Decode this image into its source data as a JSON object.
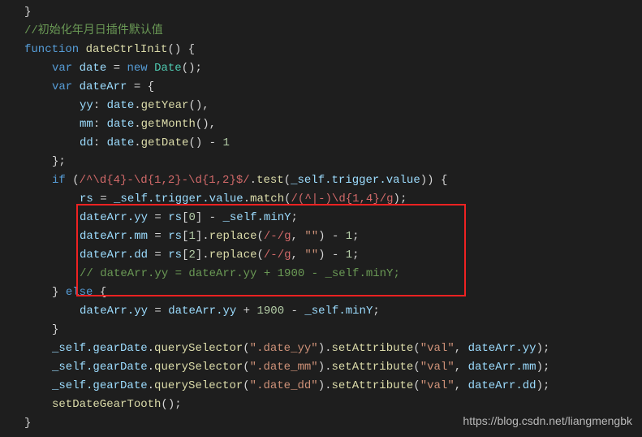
{
  "code": {
    "l1": "}",
    "l2_comment": "//初始化年月日插件默认值",
    "l3_kw_function": "function",
    "l3_name": " dateCtrlInit",
    "l3_rest": "() {",
    "l4_kw_var": "var",
    "l4_var_date": " date",
    "l4_eq": " = ",
    "l4_kw_new": "new",
    "l4_space": " ",
    "l4_class": "Date",
    "l4_rest": "();",
    "l5_kw_var": "var",
    "l5_var": " dateArr",
    "l5_rest": " = {",
    "l6_prop": "yy",
    "l6_colon": ": ",
    "l6_obj": "date",
    "l6_dot": ".",
    "l6_method": "getYear",
    "l6_rest": "(),",
    "l7_prop": "mm",
    "l7_colon": ": ",
    "l7_obj": "date",
    "l7_dot": ".",
    "l7_method": "getMonth",
    "l7_rest": "(),",
    "l8_prop": "dd",
    "l8_colon": ": ",
    "l8_obj": "date",
    "l8_dot": ".",
    "l8_method": "getDate",
    "l8_rest": "() - ",
    "l8_num": "1",
    "l9": "};",
    "l10_kw_if": "if",
    "l10_open": " (",
    "l10_regex": "/^\\d{4}-\\d{1,2}-\\d{1,2}$/",
    "l10_dot": ".",
    "l10_method": "test",
    "l10_open2": "(",
    "l10_obj": "_self",
    "l10_prop1": ".trigger",
    "l10_prop2": ".value",
    "l10_rest": ")) {",
    "l11_var": "rs",
    "l11_eq": " = ",
    "l11_obj": "_self",
    "l11_prop1": ".trigger",
    "l11_prop2": ".value",
    "l11_dot": ".",
    "l11_method": "match",
    "l11_open": "(",
    "l11_regex": "/(^|-)\\d{1,4}/g",
    "l11_rest": ");",
    "l12_obj": "dateArr",
    "l12_prop": ".yy",
    "l12_eq": " = ",
    "l12_rs": "rs",
    "l12_idx_open": "[",
    "l12_idx": "0",
    "l12_idx_close": "]",
    "l12_minus": " - ",
    "l12_self": "_self",
    "l12_miny": ".minY",
    "l12_semi": ";",
    "l13_obj": "dateArr",
    "l13_prop": ".mm",
    "l13_eq": " = ",
    "l13_rs": "rs",
    "l13_idx_open": "[",
    "l13_idx": "1",
    "l13_idx_close": "]",
    "l13_dot": ".",
    "l13_method": "replace",
    "l13_open": "(",
    "l13_regex": "/-/g",
    "l13_comma": ", ",
    "l13_str": "\"\"",
    "l13_close": ")",
    "l13_minus": " - ",
    "l13_num": "1",
    "l13_semi": ";",
    "l14_obj": "dateArr",
    "l14_prop": ".dd",
    "l14_eq": " = ",
    "l14_rs": "rs",
    "l14_idx_open": "[",
    "l14_idx": "2",
    "l14_idx_close": "]",
    "l14_dot": ".",
    "l14_method": "replace",
    "l14_open": "(",
    "l14_regex": "/-/g",
    "l14_comma": ", ",
    "l14_str": "\"\"",
    "l14_close": ")",
    "l14_minus": " - ",
    "l14_num": "1",
    "l14_semi": ";",
    "l15_comment": "// dateArr.yy = dateArr.yy + 1900 - _self.minY;",
    "l16_close": "} ",
    "l16_kw_else": "else",
    "l16_open": " {",
    "l17_obj": "dateArr",
    "l17_prop": ".yy",
    "l17_eq": " = ",
    "l17_obj2": "dateArr",
    "l17_prop2": ".yy",
    "l17_plus": " + ",
    "l17_num": "1900",
    "l17_minus": " - ",
    "l17_self": "_self",
    "l17_miny": ".minY",
    "l17_semi": ";",
    "l18": "}",
    "l19_obj": "_self",
    "l19_prop": ".gearDate",
    "l19_dot": ".",
    "l19_method": "querySelector",
    "l19_open": "(",
    "l19_str": "\".date_yy\"",
    "l19_close": ").",
    "l19_method2": "setAttribute",
    "l19_open2": "(",
    "l19_str2": "\"val\"",
    "l19_comma": ", ",
    "l19_obj2": "dateArr",
    "l19_prop2": ".yy",
    "l19_rest": ");",
    "l20_obj": "_self",
    "l20_prop": ".gearDate",
    "l20_dot": ".",
    "l20_method": "querySelector",
    "l20_open": "(",
    "l20_str": "\".date_mm\"",
    "l20_close": ").",
    "l20_method2": "setAttribute",
    "l20_open2": "(",
    "l20_str2": "\"val\"",
    "l20_comma": ", ",
    "l20_obj2": "dateArr",
    "l20_prop2": ".mm",
    "l20_rest": ");",
    "l21_obj": "_self",
    "l21_prop": ".gearDate",
    "l21_dot": ".",
    "l21_method": "querySelector",
    "l21_open": "(",
    "l21_str": "\".date_dd\"",
    "l21_close": ").",
    "l21_method2": "setAttribute",
    "l21_open2": "(",
    "l21_str2": "\"val\"",
    "l21_comma": ", ",
    "l21_obj2": "dateArr",
    "l21_prop2": ".dd",
    "l21_rest": ");",
    "l22_method": "setDateGearTooth",
    "l22_rest": "();",
    "l23": "}"
  },
  "watermark": "https://blog.csdn.net/liangmengbk"
}
